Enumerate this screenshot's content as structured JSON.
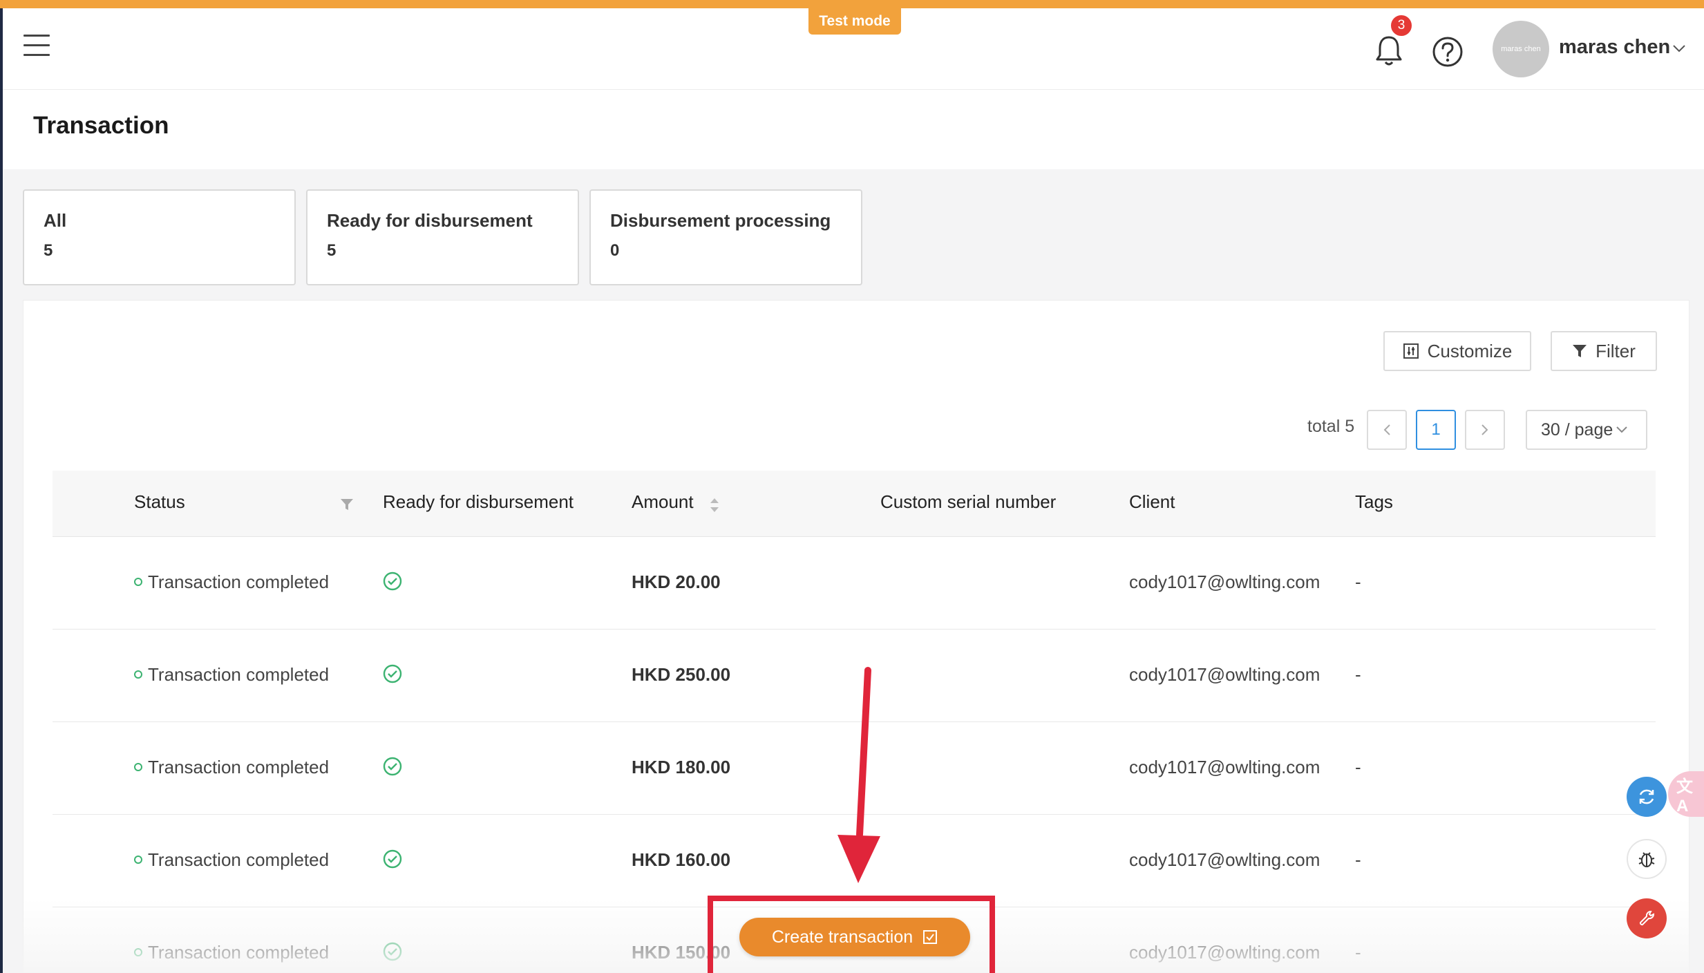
{
  "header": {
    "test_mode": "Test mode",
    "notification_count": "3",
    "avatar_text": "maras chen",
    "user_name": "maras chen"
  },
  "page": {
    "title": "Transaction"
  },
  "stat_cards": [
    {
      "label": "All",
      "count": "5"
    },
    {
      "label": "Ready for disbursement",
      "count": "5"
    },
    {
      "label": "Disbursement processing",
      "count": "0"
    }
  ],
  "toolbar": {
    "customize_label": "Customize",
    "filter_label": "Filter"
  },
  "pagination": {
    "total": "total 5",
    "current_page": "1",
    "page_size": "30 / page"
  },
  "table": {
    "columns": [
      "Status",
      "Ready for disbursement",
      "Amount",
      "Custom serial number",
      "Client",
      "Tags"
    ],
    "rows": [
      {
        "status": "Transaction completed",
        "amount": "HKD 20.00",
        "serial": "",
        "client": "cody1017@owlting.com",
        "tags": "-"
      },
      {
        "status": "Transaction completed",
        "amount": "HKD 250.00",
        "serial": "",
        "client": "cody1017@owlting.com",
        "tags": "-"
      },
      {
        "status": "Transaction completed",
        "amount": "HKD 180.00",
        "serial": "",
        "client": "cody1017@owlting.com",
        "tags": "-"
      },
      {
        "status": "Transaction completed",
        "amount": "HKD 160.00",
        "serial": "",
        "client": "cody1017@owlting.com",
        "tags": "-"
      },
      {
        "status": "Transaction completed",
        "amount": "HKD 150.00",
        "serial": "",
        "client": "cody1017@owlting.com",
        "tags": "-"
      }
    ]
  },
  "floating": {
    "translate_icon_text": "文A"
  },
  "create_button": {
    "label": "Create transaction"
  },
  "colors": {
    "accent": "#f2a23c",
    "create_button": "#e98a2c",
    "highlight": "#e0253a",
    "link_blue": "#2f8fe0",
    "status_green": "#3cb371"
  },
  "icons": [
    "menu-icon",
    "bell-icon",
    "help-icon",
    "customize-icon",
    "filter-icon",
    "sort-icon",
    "check-circle-icon",
    "refresh-icon",
    "translate-icon",
    "bug-icon",
    "wrench-icon",
    "external-icon"
  ]
}
